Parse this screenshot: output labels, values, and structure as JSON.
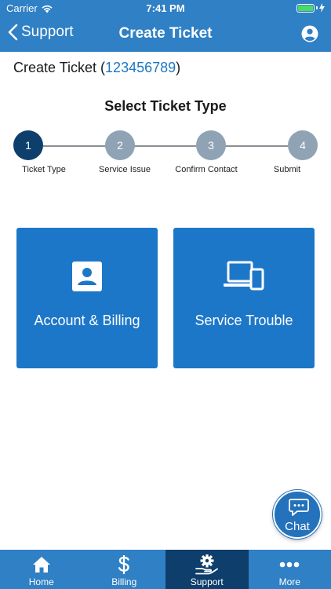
{
  "status_bar": {
    "carrier": "Carrier",
    "time": "7:41 PM"
  },
  "nav": {
    "back_label": "Support",
    "title": "Create Ticket"
  },
  "ticket": {
    "prefix": "Create Ticket (",
    "id": "123456789",
    "suffix": ")"
  },
  "section_title": "Select Ticket Type",
  "steps": [
    {
      "number": "1",
      "label": "Ticket Type",
      "active": true
    },
    {
      "number": "2",
      "label": "Service Issue",
      "active": false
    },
    {
      "number": "3",
      "label": "Confirm Contact",
      "active": false
    },
    {
      "number": "4",
      "label": "Submit",
      "active": false
    }
  ],
  "tiles": [
    {
      "label": "Account & Billing",
      "icon": "account-card-icon"
    },
    {
      "label": "Service Trouble",
      "icon": "devices-icon"
    }
  ],
  "chat": {
    "label": "Chat",
    "icon": "chat-bubble-icon"
  },
  "tabs": [
    {
      "label": "Home",
      "icon": "home-icon",
      "active": false
    },
    {
      "label": "Billing",
      "icon": "dollar-icon",
      "active": false
    },
    {
      "label": "Support",
      "icon": "support-gear-hand-icon",
      "active": true
    },
    {
      "label": "More",
      "icon": "more-dots-icon",
      "active": false
    }
  ],
  "colors": {
    "header_blue": "#2f80c5",
    "tile_blue": "#1d77c8",
    "active_dark": "#0e3e6b",
    "inactive_step": "#8fa3b5",
    "link_blue": "#1d78c4"
  }
}
